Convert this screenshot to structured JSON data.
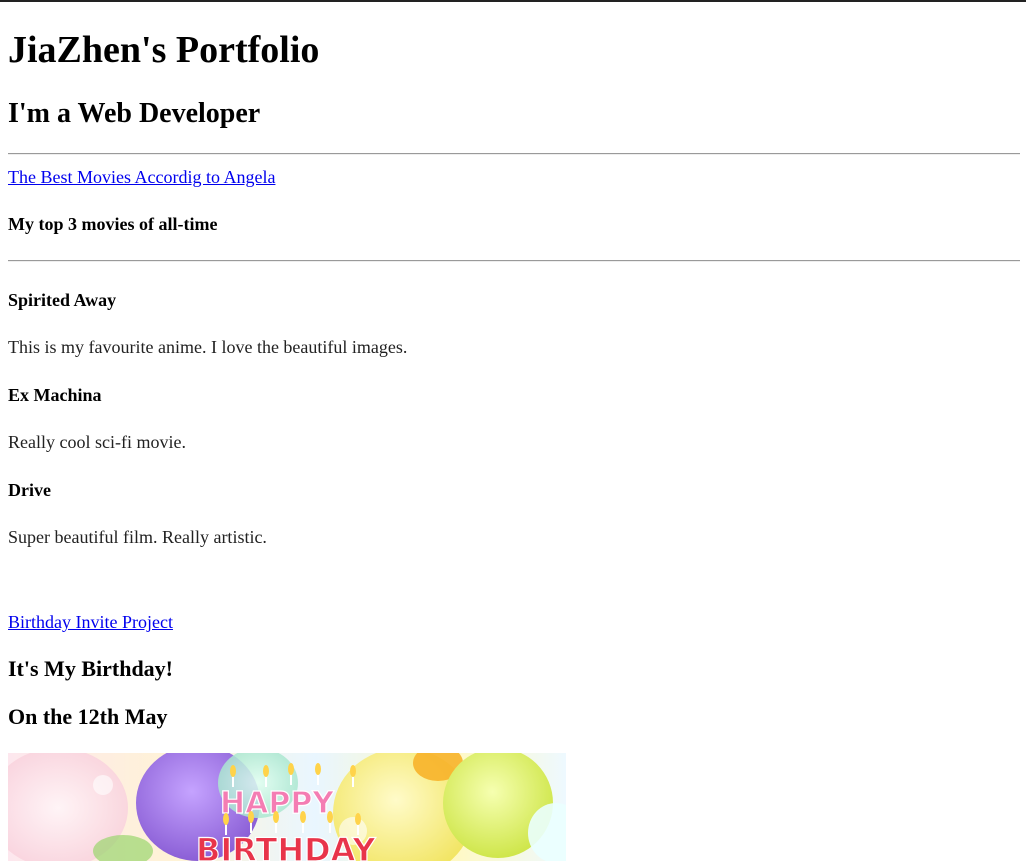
{
  "header": {
    "title": "JiaZhen's Portfolio",
    "role": "I'm a Web Developer"
  },
  "movies_section": {
    "link_text": "The Best Movies Accordig to Angela",
    "subtitle": "My top 3 movies of all-time",
    "movies": [
      {
        "title": "Spirited Away",
        "description": "This is my favourite anime. I love the beautiful images."
      },
      {
        "title": "Ex Machina",
        "description": "Really cool sci-fi movie."
      },
      {
        "title": "Drive",
        "description": "Super beautiful film. Really artistic."
      }
    ]
  },
  "birthday_section": {
    "link_text": "Birthday Invite Project",
    "title": "It's My Birthday!",
    "date": "On the 12th May",
    "image_text_top": "HAPPY",
    "image_text_bottom": "BIRTHDAY"
  }
}
